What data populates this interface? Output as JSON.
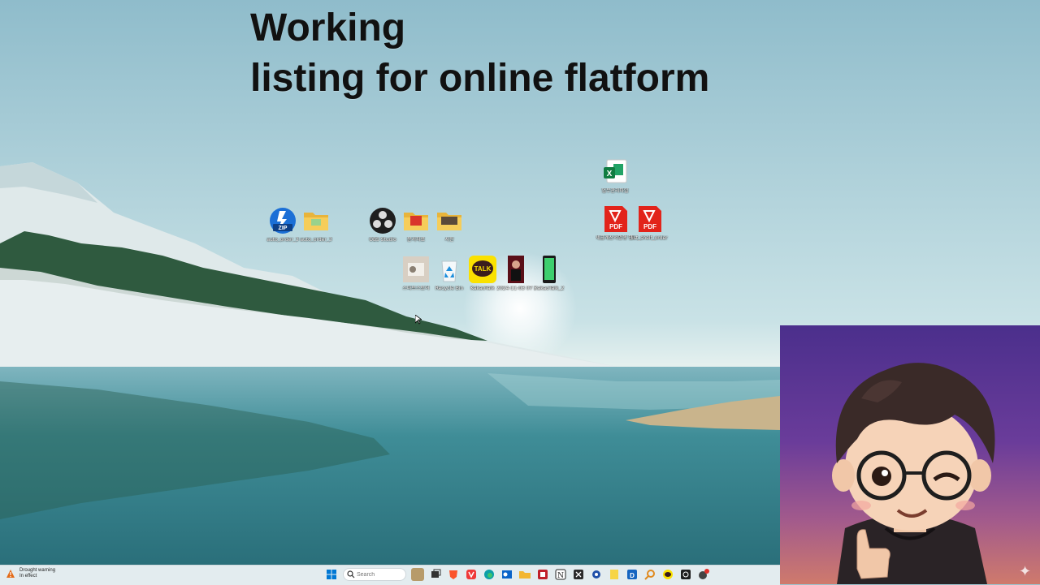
{
  "overlay": {
    "line1": "Working",
    "line2": "listing for online flatform"
  },
  "desktop_icons": {
    "zip": "auto_order_3",
    "folder_auto": "auto_order_3",
    "obs": "OBS Studio",
    "folder_red": "문서자료",
    "folder_photo": "사진",
    "excel": "업무관리파일",
    "pdf_1": "세금계산서발행 안내",
    "pdf_2": "list_shelf_order",
    "photo": "스마트스토어",
    "recycle": "Recycle Bin",
    "kakaotalk": "KakaoTalk",
    "portrait": "2024-11-03 07 25 55",
    "phone": "KakaoTalk_2"
  },
  "taskbar": {
    "weather_title": "Drought warning",
    "weather_sub": "In effect",
    "search_placeholder": "Search"
  },
  "colors": {
    "taskbar_bg": "#e3ecef",
    "pip_gradient_top": "#4b2f8c",
    "pip_gradient_bottom": "#cf7a6c",
    "windows_blue": "#0078d4"
  }
}
